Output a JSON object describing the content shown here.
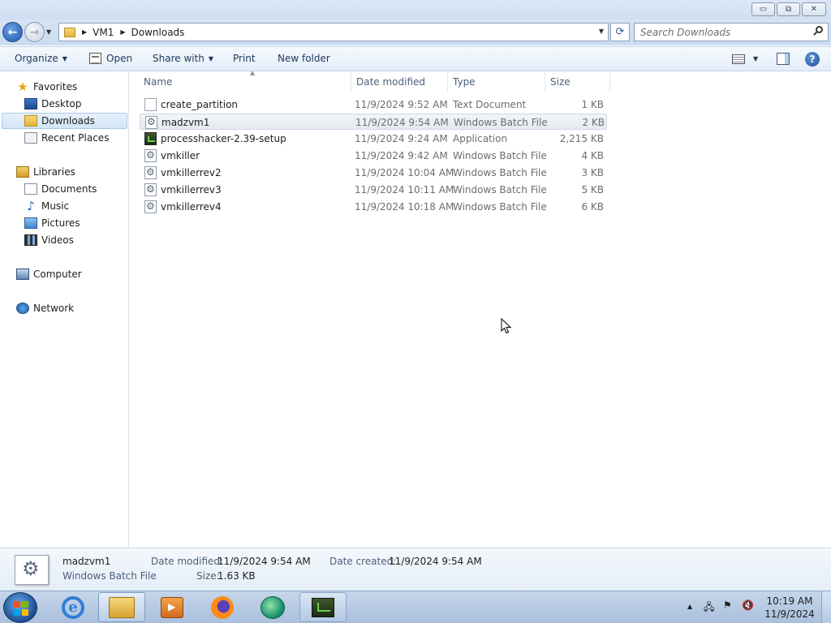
{
  "window": {
    "controls": {
      "minimize": "▭",
      "maximize": "⧉",
      "close": "✕"
    }
  },
  "address": {
    "breadcrumbs": [
      "VM1",
      "Downloads"
    ],
    "search_placeholder": "Search Downloads"
  },
  "toolbar": {
    "organize": "Organize",
    "open": "Open",
    "share_with": "Share with",
    "print": "Print",
    "new_folder": "New folder"
  },
  "nav": {
    "favorites": {
      "label": "Favorites",
      "items": [
        {
          "label": "Desktop",
          "icon": "desktop-icon"
        },
        {
          "label": "Downloads",
          "icon": "downloads-folder-icon",
          "selected": true
        },
        {
          "label": "Recent Places",
          "icon": "recent-places-icon"
        }
      ]
    },
    "libraries": {
      "label": "Libraries",
      "items": [
        {
          "label": "Documents",
          "icon": "documents-icon"
        },
        {
          "label": "Music",
          "icon": "music-icon"
        },
        {
          "label": "Pictures",
          "icon": "pictures-icon"
        },
        {
          "label": "Videos",
          "icon": "videos-icon"
        }
      ]
    },
    "computer": "Computer",
    "network": "Network"
  },
  "columns": [
    "Name",
    "Date modified",
    "Type",
    "Size"
  ],
  "files": [
    {
      "name": "create_partition",
      "date": "11/9/2024 9:52 AM",
      "type": "Text Document",
      "size": "1 KB",
      "icon": "text-file-icon"
    },
    {
      "name": "madzvm1",
      "date": "11/9/2024 9:54 AM",
      "type": "Windows Batch File",
      "size": "2 KB",
      "icon": "batch-file-icon",
      "selected": true
    },
    {
      "name": "processhacker-2.39-setup",
      "date": "11/9/2024 9:24 AM",
      "type": "Application",
      "size": "2,215 KB",
      "icon": "application-icon"
    },
    {
      "name": "vmkiller",
      "date": "11/9/2024 9:42 AM",
      "type": "Windows Batch File",
      "size": "4 KB",
      "icon": "batch-file-icon"
    },
    {
      "name": "vmkillerrev2",
      "date": "11/9/2024 10:04 AM",
      "type": "Windows Batch File",
      "size": "3 KB",
      "icon": "batch-file-icon"
    },
    {
      "name": "vmkillerrev3",
      "date": "11/9/2024 10:11 AM",
      "type": "Windows Batch File",
      "size": "5 KB",
      "icon": "batch-file-icon"
    },
    {
      "name": "vmkillerrev4",
      "date": "11/9/2024 10:18 AM",
      "type": "Windows Batch File",
      "size": "6 KB",
      "icon": "batch-file-icon"
    }
  ],
  "details": {
    "name": "madzvm1",
    "type": "Windows Batch File",
    "date_modified_label": "Date modified:",
    "date_modified": "11/9/2024 9:54 AM",
    "date_created_label": "Date created:",
    "date_created": "11/9/2024 9:54 AM",
    "size_label": "Size:",
    "size": "1.63 KB"
  },
  "taskbar": {
    "time": "10:19 AM",
    "date": "11/9/2024"
  }
}
